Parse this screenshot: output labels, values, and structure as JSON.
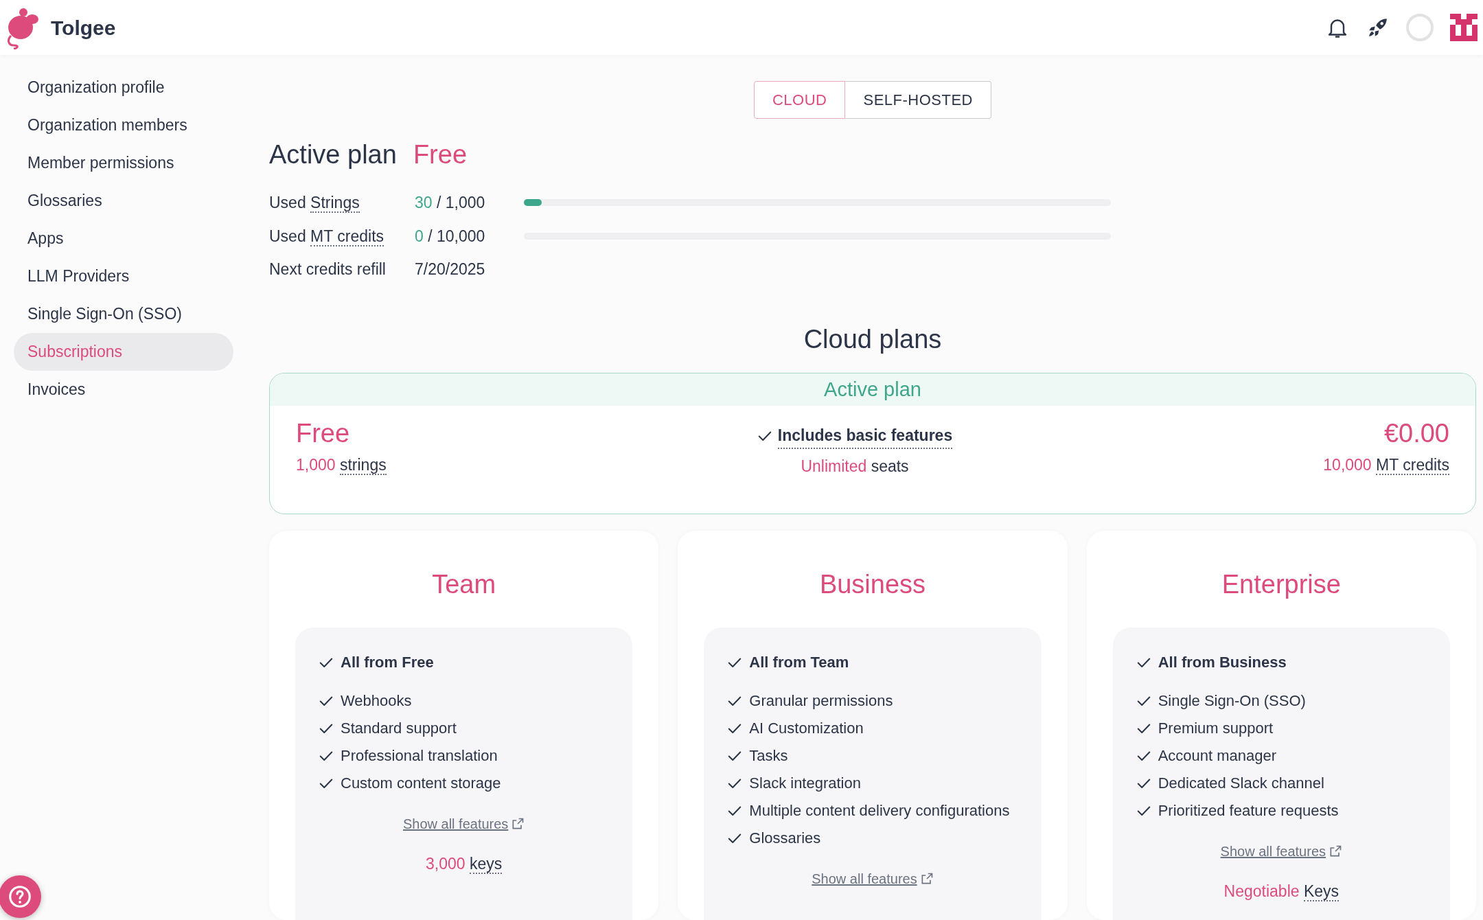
{
  "app": {
    "name": "Tolgee"
  },
  "sidebar": {
    "items": [
      {
        "label": "Organization profile",
        "selected": false
      },
      {
        "label": "Organization members",
        "selected": false
      },
      {
        "label": "Member permissions",
        "selected": false
      },
      {
        "label": "Glossaries",
        "selected": false
      },
      {
        "label": "Apps",
        "selected": false
      },
      {
        "label": "LLM Providers",
        "selected": false
      },
      {
        "label": "Single Sign-On (SSO)",
        "selected": false
      },
      {
        "label": "Subscriptions",
        "selected": true
      },
      {
        "label": "Invoices",
        "selected": false
      }
    ]
  },
  "plan_toggle": [
    {
      "label": "CLOUD",
      "selected": true
    },
    {
      "label": "SELF-HOSTED",
      "selected": false
    }
  ],
  "active_plan": {
    "heading": "Active plan",
    "plan_name": "Free",
    "usage": [
      {
        "label": "Used",
        "term": "Strings",
        "used": "30",
        "total": "/ 1,000",
        "level": 0.03
      },
      {
        "label": "Used",
        "term": "MT credits",
        "used": "0",
        "total": "/ 10,000",
        "level": 0
      }
    ],
    "refill": {
      "label": "Next credits refill",
      "value": "7/20/2025"
    }
  },
  "cloud_plans": {
    "heading": "Cloud plans",
    "active_card": {
      "banner": "Active plan",
      "name": "Free",
      "amount": "1,000",
      "amount_unit": "strings",
      "feature": "Includes basic features",
      "seats_value": "Unlimited",
      "seats_unit": "seats",
      "price": "€0.00",
      "credits_value": "10,000",
      "credits_unit": "MT credits"
    },
    "plans": [
      {
        "name": "Team",
        "features": [
          {
            "text": "All from Free",
            "bold": true
          },
          {
            "text": "Webhooks",
            "bold": false
          },
          {
            "text": "Standard support",
            "bold": false
          },
          {
            "text": "Professional translation",
            "bold": false
          },
          {
            "text": "Custom content storage",
            "bold": false
          }
        ],
        "link": "Show all features",
        "limit": {
          "value": "3,000",
          "unit": "keys"
        }
      },
      {
        "name": "Business",
        "features": [
          {
            "text": "All from Team",
            "bold": true
          },
          {
            "text": "Granular permissions",
            "bold": false
          },
          {
            "text": "AI Customization",
            "bold": false
          },
          {
            "text": "Tasks",
            "bold": false
          },
          {
            "text": "Slack integration",
            "bold": false
          },
          {
            "text": "Multiple content delivery configurations",
            "bold": false
          },
          {
            "text": "Glossaries",
            "bold": false
          }
        ],
        "link": "Show all features"
      },
      {
        "name": "Enterprise",
        "features": [
          {
            "text": "All from Business",
            "bold": true
          },
          {
            "text": "Single Sign-On (SSO)",
            "bold": false
          },
          {
            "text": "Premium support",
            "bold": false
          },
          {
            "text": "Account manager",
            "bold": false
          },
          {
            "text": "Dedicated Slack channel",
            "bold": false
          },
          {
            "text": "Prioritized feature requests",
            "bold": false
          }
        ],
        "link": "Show all features",
        "limit": {
          "value": "Negotiable",
          "unit": "Keys"
        }
      }
    ]
  }
}
